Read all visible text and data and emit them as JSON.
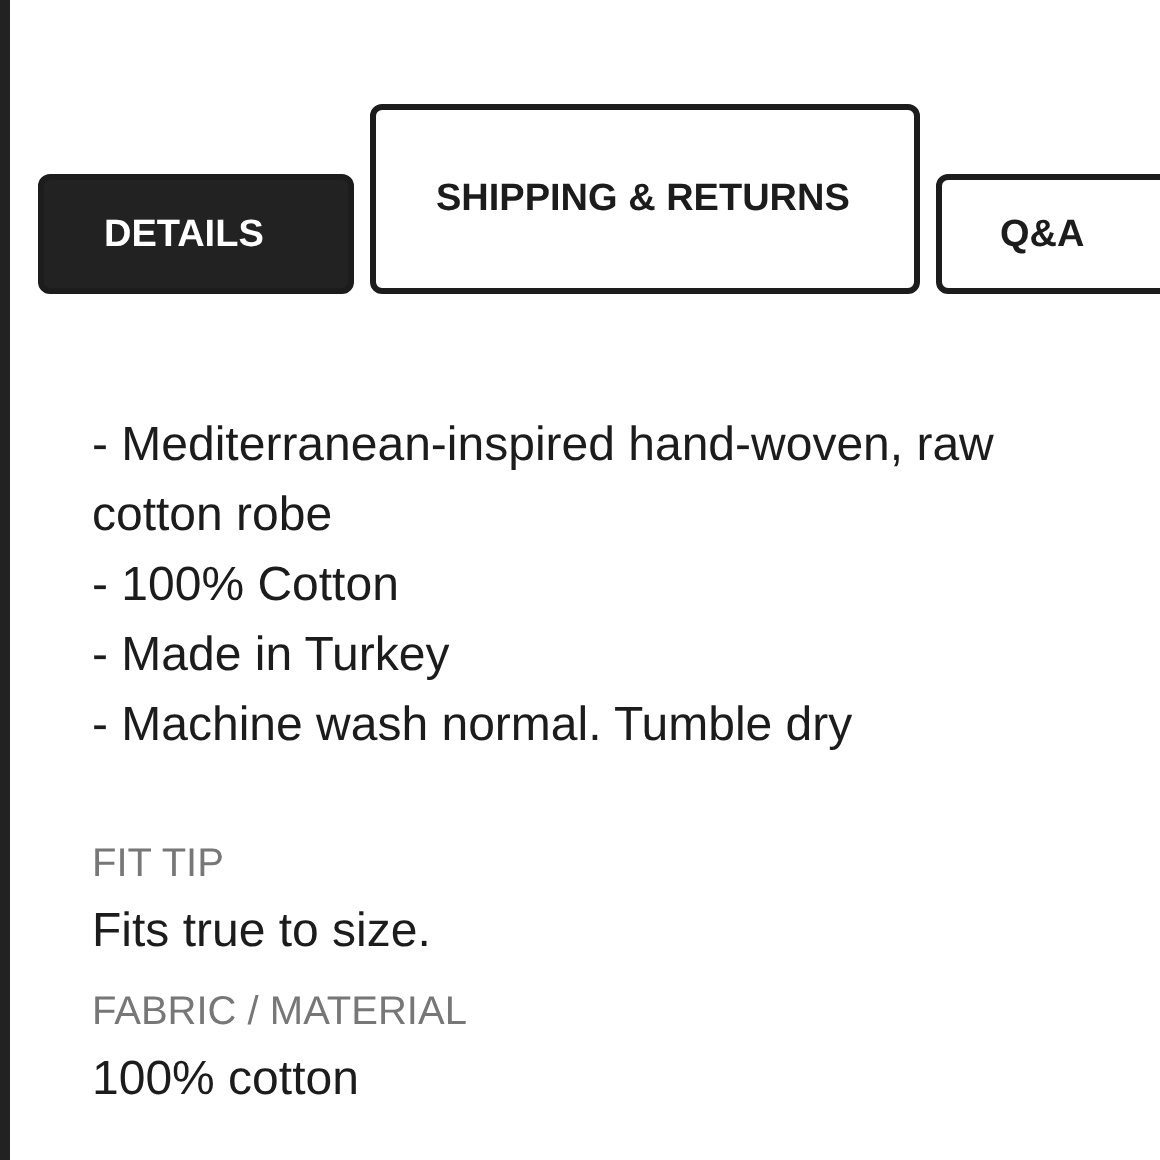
{
  "tabs": [
    {
      "label": "DETAILS",
      "selected": true
    },
    {
      "label": "SHIPPING & RETURNS",
      "selected": false
    },
    {
      "label": "Q&A",
      "selected": false
    }
  ],
  "details": [
    "- Mediterranean-inspired hand-woven, raw cotton robe",
    "- 100% Cotton",
    "- Made in Turkey",
    "- Machine wash normal. Tumble dry"
  ],
  "sections": [
    {
      "heading": "FIT TIP",
      "text": "Fits true to size."
    },
    {
      "heading": "FABRIC / MATERIAL",
      "text": "100% cotton"
    }
  ]
}
